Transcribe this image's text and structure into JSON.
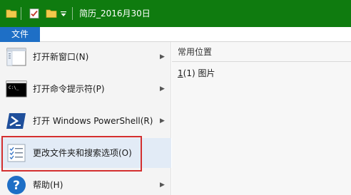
{
  "titlebar": {
    "title": "简历_2016月30日",
    "quick_access": [
      "folder-icon",
      "properties-checkmark-icon",
      "new-folder-icon",
      "customize-dropdown-icon"
    ]
  },
  "ribbon": {
    "file_tab_label": "文件"
  },
  "menu": {
    "items": [
      {
        "label": "打开新窗口(N)",
        "icon": "window-icon",
        "has_submenu": true
      },
      {
        "label": "打开命令提示符(P)",
        "icon": "command-prompt-icon",
        "has_submenu": true
      },
      {
        "label": "打开 Windows PowerShell(R)",
        "icon": "powershell-icon",
        "has_submenu": true
      },
      {
        "label": "更改文件夹和搜索选项(O)",
        "icon": "options-checklist-icon",
        "has_submenu": false,
        "selected": true
      },
      {
        "label": "帮助(H)",
        "icon": "help-icon",
        "has_submenu": true
      }
    ]
  },
  "recent": {
    "title": "常用位置",
    "items": [
      {
        "number": "1",
        "label": "(1)  图片"
      }
    ]
  },
  "colors": {
    "titlebar": "#0f7b0f",
    "file_tab": "#1e6fc6",
    "highlight_box": "#d32f2f",
    "selected_item": "#e2ebf6"
  }
}
